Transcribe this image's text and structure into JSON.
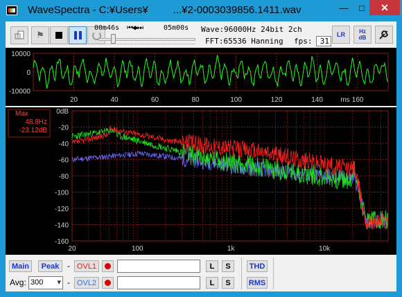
{
  "window": {
    "title": "WaveSpectra - C:¥Users¥",
    "title_tail": "...¥2-0003039856.1411.wav",
    "min_glyph": "—",
    "max_glyph": "□",
    "close_glyph": "✕"
  },
  "toolbar": {
    "elapsed": "00m46s",
    "transport": "⏮◀▶⏭",
    "total": "05m00s",
    "wave_info": "Wave:96000Hz 24bit 2ch",
    "fft_info": "FFT:65536 Hanning",
    "fps_label": "fps:",
    "fps_value": "31",
    "lr_label": "LR",
    "hz_label": "Hz dB",
    "position_fraction": 0.153
  },
  "wave": {
    "y_ticks": [
      "10000",
      "0",
      "-10000"
    ],
    "x_ticks": [
      "20",
      "40",
      "60",
      "80",
      "100",
      "120",
      "140",
      "160"
    ],
    "x_unit": "ms"
  },
  "spectrum": {
    "max_label": "Max",
    "max_freq": "48.8Hz",
    "max_level": "-23.12dB",
    "y_ticks": [
      "0dB",
      "-20",
      "-40",
      "-60",
      "-80",
      "-100",
      "-120",
      "-140",
      "-160"
    ],
    "x_ticks": [
      "20",
      "100",
      "1k",
      "10k"
    ]
  },
  "bottom": {
    "main_label": "Main",
    "peak_label": "Peak",
    "dash1": "-",
    "dash2": "-",
    "ovl1_label": "OVL1",
    "ovl2_label": "OVL2",
    "avg_label": "Avg:",
    "avg_value": "300",
    "l_label": "L",
    "s_label": "S",
    "thd_label": "THD",
    "rms_label": "RMS"
  },
  "colors": {
    "wave_trace": "#20ff20",
    "grid": "#8b1a1a",
    "spec_red": "#ff2020",
    "spec_green": "#20e020",
    "spec_blue": "#6a6aff"
  }
}
